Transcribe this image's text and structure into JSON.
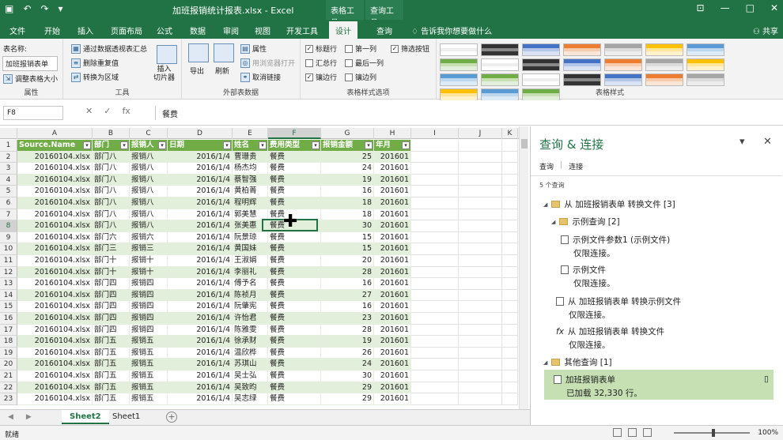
{
  "title": {
    "qa_undo": "↶",
    "qa_redo": "↷",
    "text": "加班报销统计报表.xlsx  -  Excel",
    "ctx1": "表格工具",
    "ctx2": "查询工具",
    "win_min": "—",
    "win_max": "□",
    "win_close": "✕",
    "ribbon_opt": "⊡"
  },
  "tabs": [
    "文件",
    "开始",
    "插入",
    "页面布局",
    "公式",
    "数据",
    "审阅",
    "视图",
    "开发工具",
    "设计",
    "查询"
  ],
  "tell": "告诉我你想要做什么",
  "share": "共享",
  "ribbon": {
    "props": {
      "label": "表名称:",
      "name": "加班报销表单",
      "resize": "调整表格大小",
      "group": "属性"
    },
    "tools": {
      "pivot": "通过数据透视表汇总",
      "dup": "删除重复值",
      "range": "转换为区域",
      "slicer": "插入\n切片器",
      "group": "工具"
    },
    "ext": {
      "export": "导出",
      "refresh": "刷新",
      "props": "属性",
      "browser": "用浏览器打开",
      "unlink": "取消链接",
      "group": "外部表数据"
    },
    "opts": {
      "header": "标题行",
      "total": "汇总行",
      "banded": "镶边行",
      "first": "第一列",
      "last": "最后一列",
      "bandedcol": "镶边列",
      "filter": "筛选按钮",
      "group": "表格样式选项"
    },
    "styles": {
      "group": "表格样式"
    }
  },
  "formula": {
    "namebox": "F8",
    "cancel": "✕",
    "enter": "✓",
    "fx": "fx",
    "value": "餐费"
  },
  "columns": [
    "A",
    "B",
    "C",
    "D",
    "E",
    "F",
    "G",
    "H",
    "I",
    "J",
    "K"
  ],
  "headers": [
    "Source.Name",
    "部门",
    "报销人",
    "日期",
    "姓名",
    "费用类型",
    "报销金额",
    "年月"
  ],
  "rows": [
    [
      "20160104.xlsx",
      "部门八",
      "报销八",
      "2016/1/4",
      "曹珊贵",
      "餐费",
      "25",
      "201601"
    ],
    [
      "20160104.xlsx",
      "部门八",
      "报销八",
      "2016/1/4",
      "杨杰均",
      "餐费",
      "24",
      "201601"
    ],
    [
      "20160104.xlsx",
      "部门八",
      "报销八",
      "2016/1/4",
      "蔡智强",
      "餐费",
      "19",
      "201601"
    ],
    [
      "20160104.xlsx",
      "部门八",
      "报销八",
      "2016/1/4",
      "黄柏菁",
      "餐费",
      "16",
      "201601"
    ],
    [
      "20160104.xlsx",
      "部门八",
      "报销八",
      "2016/1/4",
      "程明辉",
      "餐费",
      "18",
      "201601"
    ],
    [
      "20160104.xlsx",
      "部门八",
      "报销八",
      "2016/1/4",
      "郭美慧",
      "餐费",
      "18",
      "201601"
    ],
    [
      "20160104.xlsx",
      "部门八",
      "报销八",
      "2016/1/4",
      "张美惠",
      "餐费",
      "30",
      "201601"
    ],
    [
      "20160104.xlsx",
      "部门六",
      "报销六",
      "2016/1/4",
      "阮景琼",
      "餐费",
      "15",
      "201601"
    ],
    [
      "20160104.xlsx",
      "部门三",
      "报销三",
      "2016/1/4",
      "黄国妹",
      "餐费",
      "15",
      "201601"
    ],
    [
      "20160104.xlsx",
      "部门十",
      "报销十",
      "2016/1/4",
      "王淑娟",
      "餐费",
      "20",
      "201601"
    ],
    [
      "20160104.xlsx",
      "部门十",
      "报销十",
      "2016/1/4",
      "李丽礼",
      "餐费",
      "28",
      "201601"
    ],
    [
      "20160104.xlsx",
      "部门四",
      "报销四",
      "2016/1/4",
      "傅予名",
      "餐费",
      "16",
      "201601"
    ],
    [
      "20160104.xlsx",
      "部门四",
      "报销四",
      "2016/1/4",
      "陈祯月",
      "餐费",
      "27",
      "201601"
    ],
    [
      "20160104.xlsx",
      "部门四",
      "报销四",
      "2016/1/4",
      "阮肇宪",
      "餐费",
      "16",
      "201601"
    ],
    [
      "20160104.xlsx",
      "部门四",
      "报销四",
      "2016/1/4",
      "许怡君",
      "餐费",
      "23",
      "201601"
    ],
    [
      "20160104.xlsx",
      "部门四",
      "报销四",
      "2016/1/4",
      "陈雅雯",
      "餐费",
      "28",
      "201601"
    ],
    [
      "20160104.xlsx",
      "部门五",
      "报销五",
      "2016/1/4",
      "徐承财",
      "餐费",
      "19",
      "201601"
    ],
    [
      "20160104.xlsx",
      "部门五",
      "报销五",
      "2016/1/4",
      "温欣桦",
      "餐费",
      "26",
      "201601"
    ],
    [
      "20160104.xlsx",
      "部门五",
      "报销五",
      "2016/1/4",
      "苏琪山",
      "餐费",
      "24",
      "201601"
    ],
    [
      "20160104.xlsx",
      "部门五",
      "报销五",
      "2016/1/4",
      "吴士弘",
      "餐费",
      "30",
      "201601"
    ],
    [
      "20160104.xlsx",
      "部门五",
      "报销五",
      "2016/1/4",
      "吴致昀",
      "餐费",
      "29",
      "201601"
    ],
    [
      "20160104.xlsx",
      "部门五",
      "报销五",
      "2016/1/4",
      "吴志绿",
      "餐费",
      "29",
      "201601"
    ]
  ],
  "sheets": [
    "Sheet2",
    "Sheet1"
  ],
  "panel": {
    "title": "查询 & 连接",
    "tab_query": "查询",
    "tab_conn": "连接",
    "count": "5 个查询",
    "items": [
      {
        "label": "从 加班报销表单 转换文件 [3]"
      },
      {
        "label": "示例查询 [2]"
      },
      {
        "label": "示例文件参数1 (示例文件)",
        "sub": "仅限连接。"
      },
      {
        "label": "示例文件",
        "sub": "仅限连接。"
      },
      {
        "label": "从 加班报销表单 转换示例文件",
        "sub": "仅限连接。"
      },
      {
        "label": "从 加班报销表单 转换文件",
        "sub": "仅限连接。"
      },
      {
        "label": "其他查询 [1]"
      },
      {
        "label": "加班报销表单",
        "sub": "已加载 32,330 行。"
      }
    ]
  },
  "status": {
    "ready": "就绪",
    "zoom": "100%"
  }
}
